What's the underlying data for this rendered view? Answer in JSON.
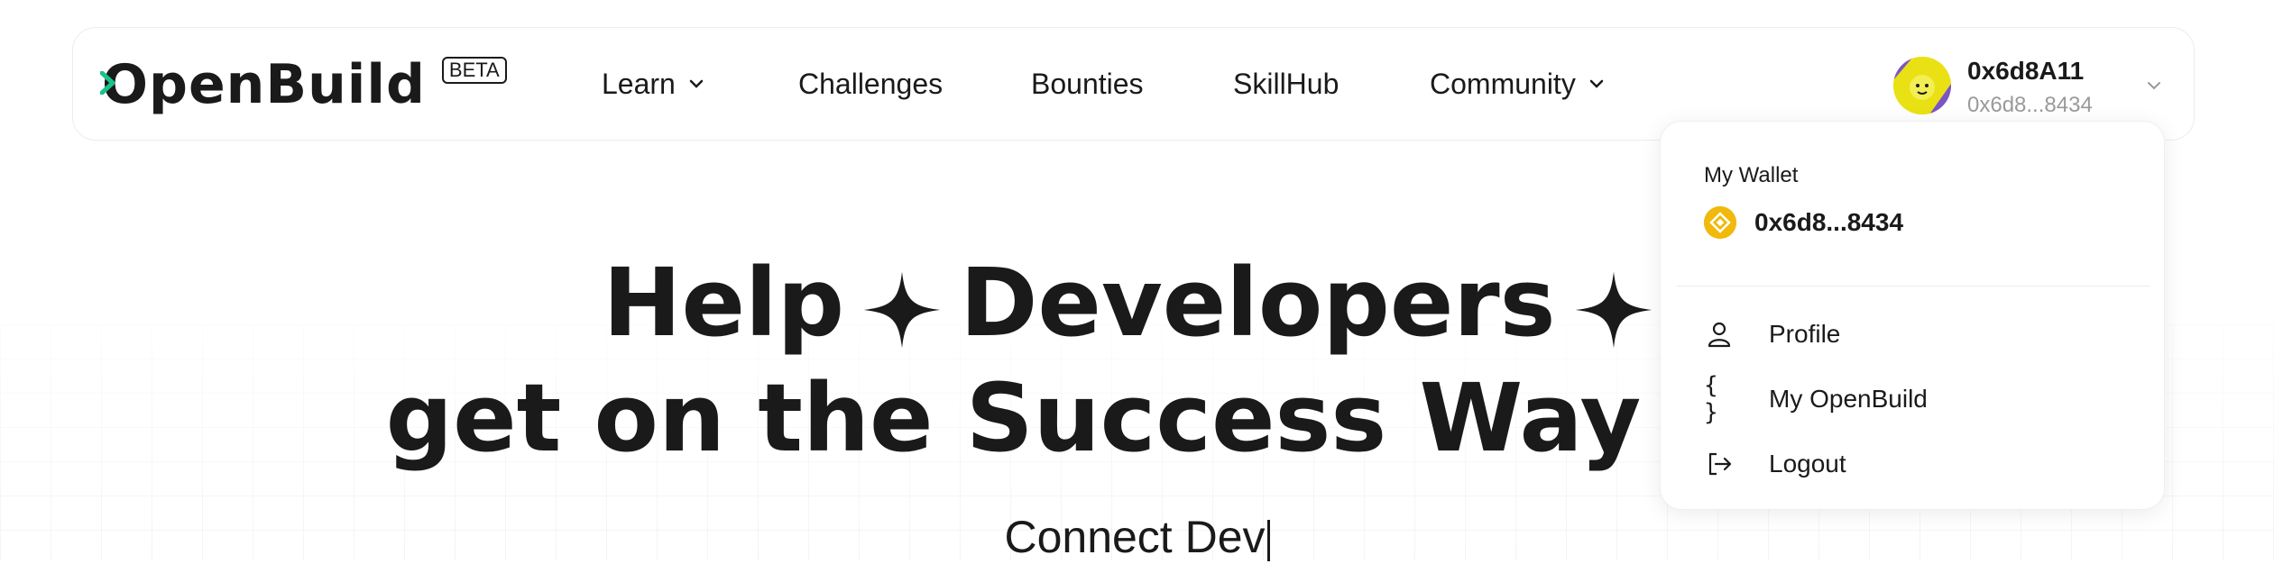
{
  "logo": {
    "text": "OpenBuild",
    "badge": "BETA",
    "accent": "#19c389"
  },
  "nav": {
    "learn": "Learn",
    "challenges": "Challenges",
    "bounties": "Bounties",
    "skillhub": "SkillHub",
    "community": "Community"
  },
  "account": {
    "name": "0x6d8A11",
    "address_short": "0x6d8...8434",
    "avatar_color": "#e9e114"
  },
  "dropdown": {
    "wallet_label": "My Wallet",
    "wallet_address": "0x6d8...8434",
    "coin_color": "#f0b90b",
    "items": [
      {
        "label": "Profile",
        "icon": "user-icon"
      },
      {
        "label": "My OpenBuild",
        "icon": "braces-icon",
        "glyph": "{ }"
      },
      {
        "label": "Logout",
        "icon": "logout-icon"
      }
    ]
  },
  "hero": {
    "line1_a": "Help",
    "line1_b": "Developers",
    "line2": "get on the Success Way to V",
    "typing": "Connect Dev"
  }
}
